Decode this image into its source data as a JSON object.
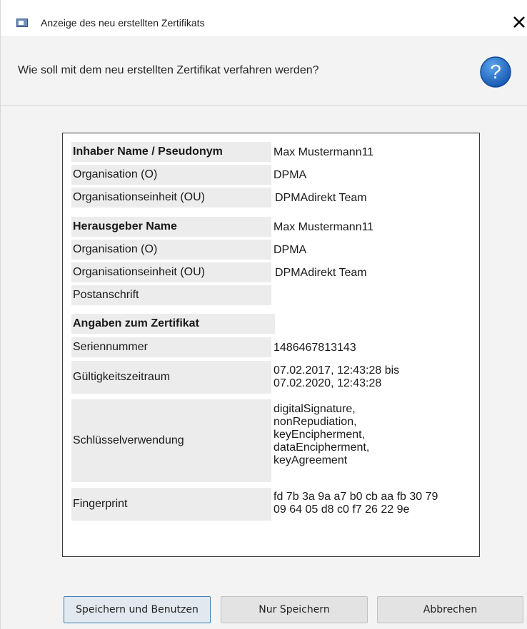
{
  "window": {
    "title": "Anzeige des neu erstellten Zertifikats"
  },
  "header": {
    "question": "Wie soll mit dem neu erstellten Zertifikat verfahren werden?"
  },
  "certificate": {
    "holder_heading": "Inhaber Name / Pseudonym",
    "holder_name": "Max Mustermann11",
    "holder_org_label": "Organisation (O)",
    "holder_org_value": "DPMA",
    "holder_ou_label": "Organisationseinheit (OU)",
    "holder_ou_value": "DPMAdirekt Team",
    "issuer_heading": "Herausgeber Name",
    "issuer_name": "Max Mustermann11",
    "issuer_org_label": "Organisation (O)",
    "issuer_org_value": "DPMA",
    "issuer_ou_label": "Organisationseinheit (OU)",
    "issuer_ou_value": "DPMAdirekt Team",
    "postal_label": "Postanschrift",
    "postal_value": "",
    "details_heading": "Angaben zum Zertifikat",
    "serial_label": "Seriennummer",
    "serial_value": "1486467813143",
    "validity_label": "Gültigkeitszeitraum",
    "validity_value": "07.02.2017, 12:43:28 bis\n07.02.2020, 12:43:28",
    "key_usage_label": "Schlüsselverwendung",
    "key_usage_value": "digitalSignature,\nnonRepudiation,\nkeyEncipherment,\ndataEncipherment,\nkeyAgreement",
    "fingerprint_label": "Fingerprint",
    "fingerprint_value": "fd 7b 3a 9a a7 b0 cb aa fb 30 79\n09 64 05 d8 c0 f7 26 22 9e"
  },
  "buttons": {
    "save_and_use": "Speichern und Benutzen",
    "save_only": "Nur Speichern",
    "cancel": "Abbrechen"
  },
  "icons": {
    "window": "window-icon",
    "close": "close-icon",
    "help": "help-question-icon"
  },
  "colors": {
    "help_blue": "#1e6fc6",
    "default_button_border": "#3c7fb1"
  }
}
